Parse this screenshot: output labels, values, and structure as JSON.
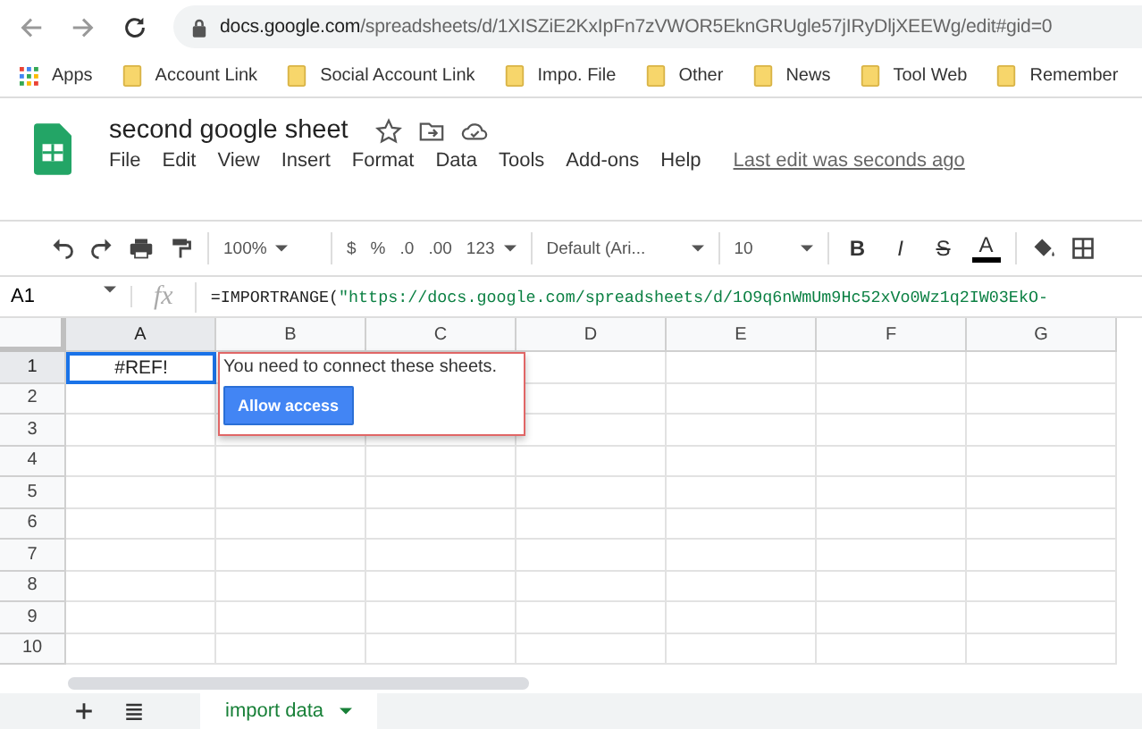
{
  "browser": {
    "url_host": "docs.google.com",
    "url_path": "/spreadsheets/d/1XISZiE2KxIpFn7zVWOR5EknGRUgle57jIRyDljXEEWg/edit#gid=0"
  },
  "bookmarks": [
    {
      "kind": "apps",
      "label": "Apps"
    },
    {
      "kind": "folder",
      "label": "Account Link"
    },
    {
      "kind": "folder",
      "label": "Social Account Link"
    },
    {
      "kind": "folder",
      "label": "Impo. File"
    },
    {
      "kind": "folder",
      "label": "Other"
    },
    {
      "kind": "folder",
      "label": "News"
    },
    {
      "kind": "folder",
      "label": "Tool Web"
    },
    {
      "kind": "folder",
      "label": "Remember"
    }
  ],
  "document": {
    "title": "second google sheet",
    "last_edit": "Last edit was seconds ago"
  },
  "menu": [
    "File",
    "Edit",
    "View",
    "Insert",
    "Format",
    "Data",
    "Tools",
    "Add-ons",
    "Help"
  ],
  "toolbar": {
    "zoom": "100%",
    "currency": "$",
    "percent": "%",
    "decimal_less": ".0",
    "decimal_more": ".00",
    "number_format": "123",
    "font": "Default (Ari...",
    "font_size": "10",
    "bold": "B",
    "italic": "I",
    "strikethrough": "S",
    "text_color": "A"
  },
  "formula_bar": {
    "cell_ref": "A1",
    "fx": "fx",
    "formula_prefix": "=IMPORTRANGE(",
    "formula_string": "\"https://docs.google.com/spreadsheets/d/1O9q6nWmUm9Hc52xVo0Wz1q2IW03EkO-"
  },
  "grid": {
    "columns": [
      "A",
      "B",
      "C",
      "D",
      "E",
      "F",
      "G"
    ],
    "rows": [
      {
        "label": "1",
        "cells": [
          {
            "value": "#REF!",
            "selected": true
          }
        ]
      },
      {
        "label": "2"
      },
      {
        "label": "3"
      },
      {
        "label": "4"
      },
      {
        "label": "5"
      },
      {
        "label": "6"
      },
      {
        "label": "7"
      },
      {
        "label": "8"
      },
      {
        "label": "9"
      },
      {
        "label": "10"
      }
    ]
  },
  "popup": {
    "message": "You need to connect these sheets.",
    "button": "Allow access"
  },
  "sheet_tabs": [
    {
      "label": "import data",
      "selected": true
    }
  ]
}
